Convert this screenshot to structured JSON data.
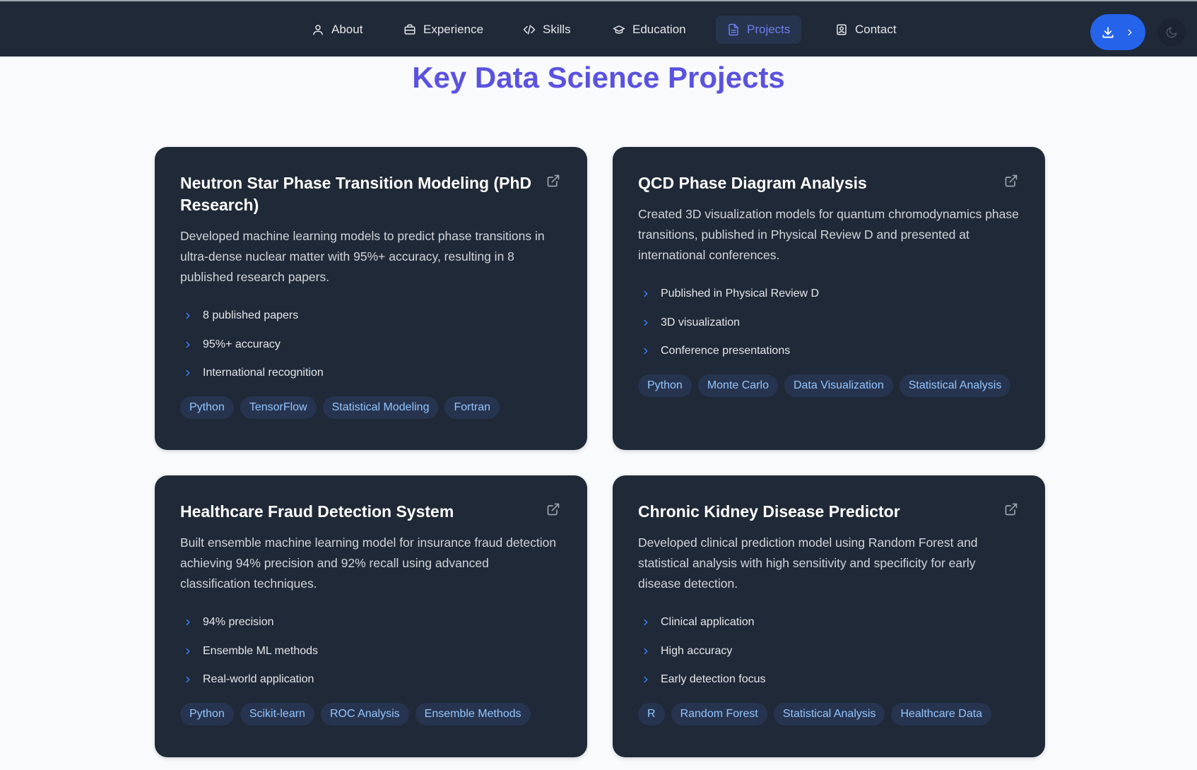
{
  "nav": {
    "items": [
      {
        "label": "About",
        "icon": "user-icon"
      },
      {
        "label": "Experience",
        "icon": "briefcase-icon"
      },
      {
        "label": "Skills",
        "icon": "code-icon"
      },
      {
        "label": "Education",
        "icon": "graduation-cap-icon"
      },
      {
        "label": "Projects",
        "icon": "document-icon",
        "active": true
      },
      {
        "label": "Contact",
        "icon": "contact-icon"
      }
    ],
    "download_icon": "download-icon",
    "chevron_icon": "chevron-right-icon",
    "theme_icon": "moon-icon"
  },
  "page": {
    "title": "Key Data Science Projects"
  },
  "colors": {
    "nav_bg": "#1f2937",
    "card_bg": "#1f2937",
    "accent": "#2563eb",
    "title_gradient_start": "#3b5bdb",
    "title_gradient_end": "#7c3aed",
    "tag_text": "#93c5fd",
    "tag_bg": "#27344f"
  },
  "projects": [
    {
      "title": "Neutron Star Phase Transition Modeling (PhD Research)",
      "description": "Developed machine learning models to predict phase transitions in ultra-dense nuclear matter with 95%+ accuracy, resulting in 8 published research papers.",
      "highlights": [
        "8 published papers",
        "95%+ accuracy",
        "International recognition"
      ],
      "tags": [
        "Python",
        "TensorFlow",
        "Statistical Modeling",
        "Fortran"
      ]
    },
    {
      "title": "QCD Phase Diagram Analysis",
      "description": "Created 3D visualization models for quantum chromodynamics phase transitions, published in Physical Review D and presented at international conferences.",
      "highlights": [
        "Published in Physical Review D",
        "3D visualization",
        "Conference presentations"
      ],
      "tags": [
        "Python",
        "Monte Carlo",
        "Data Visualization",
        "Statistical Analysis"
      ]
    },
    {
      "title": "Healthcare Fraud Detection System",
      "description": "Built ensemble machine learning model for insurance fraud detection achieving 94% precision and 92% recall using advanced classification techniques.",
      "highlights": [
        "94% precision",
        "Ensemble ML methods",
        "Real-world application"
      ],
      "tags": [
        "Python",
        "Scikit-learn",
        "ROC Analysis",
        "Ensemble Methods"
      ]
    },
    {
      "title": "Chronic Kidney Disease Predictor",
      "description": "Developed clinical prediction model using Random Forest and statistical analysis with high sensitivity and specificity for early disease detection.",
      "highlights": [
        "Clinical application",
        "High accuracy",
        "Early detection focus"
      ],
      "tags": [
        "R",
        "Random Forest",
        "Statistical Analysis",
        "Healthcare Data"
      ]
    }
  ]
}
